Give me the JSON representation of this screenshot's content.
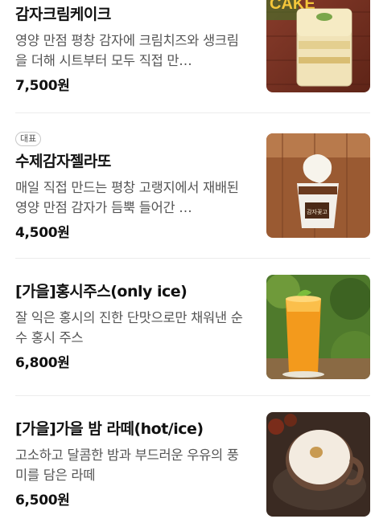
{
  "menu": [
    {
      "name": "감자크림케이크",
      "desc": "영양 만점 평창 감자에 크림치즈와 생크림을 더해 시트부터 모두 직접 만…",
      "price": "7,500원",
      "badge": "",
      "image_text": "CAKE"
    },
    {
      "name": "수제감자젤라또",
      "desc": "매일 직접 만드는 평창 고랭지에서 재배된 영양 만점 감자가 듬뿍 들어간 …",
      "price": "4,500원",
      "badge": "대표",
      "image_text": "감자꽃고"
    },
    {
      "name": "[가을]홍시주스(only ice)",
      "desc": "잘 익은 홍시의 진한 단맛으로만 채워낸 순수 홍시 주스",
      "price": "6,800원",
      "badge": ""
    },
    {
      "name": "[가을]가을 밤 라떼(hot/ice)",
      "desc": "고소하고 달콤한 밤과 부드러운 우유의 풍미를 담은 라떼",
      "price": "6,500원",
      "badge": ""
    }
  ]
}
